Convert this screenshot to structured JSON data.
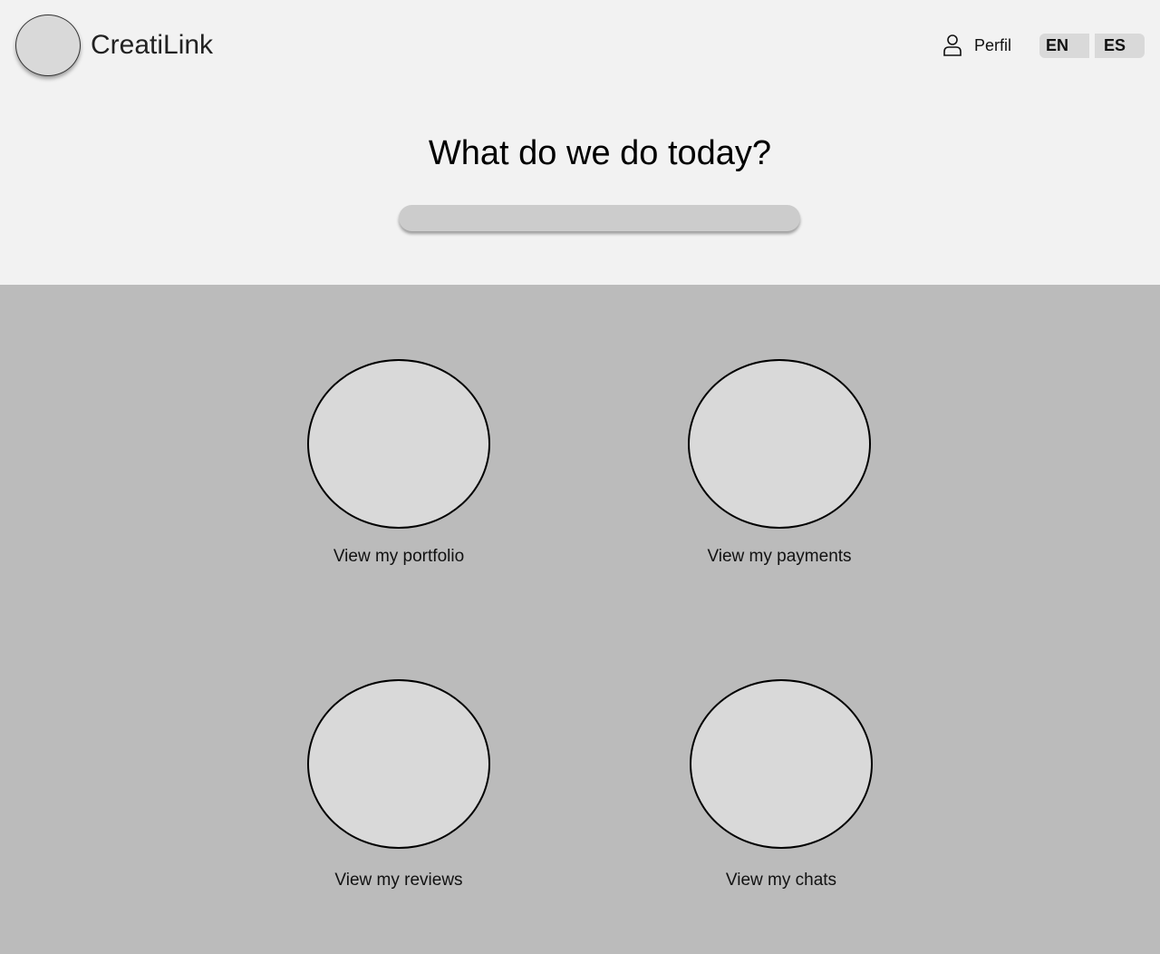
{
  "header": {
    "brand": "CreatiLink",
    "profile_label": "Perfil",
    "languages": [
      "EN",
      "ES"
    ]
  },
  "hero": {
    "title": "What do we do today?",
    "search_placeholder": ""
  },
  "options": [
    {
      "label": "View my portfolio"
    },
    {
      "label": "View my payments"
    },
    {
      "label": "View my reviews"
    },
    {
      "label": "View my chats"
    }
  ],
  "colors": {
    "header_bg": "#f2f2f2",
    "main_bg": "#bbbbbb",
    "circle_fill": "#d9d9d9",
    "search_bg": "#cccccc"
  },
  "icons": {
    "profile": "user-icon"
  }
}
